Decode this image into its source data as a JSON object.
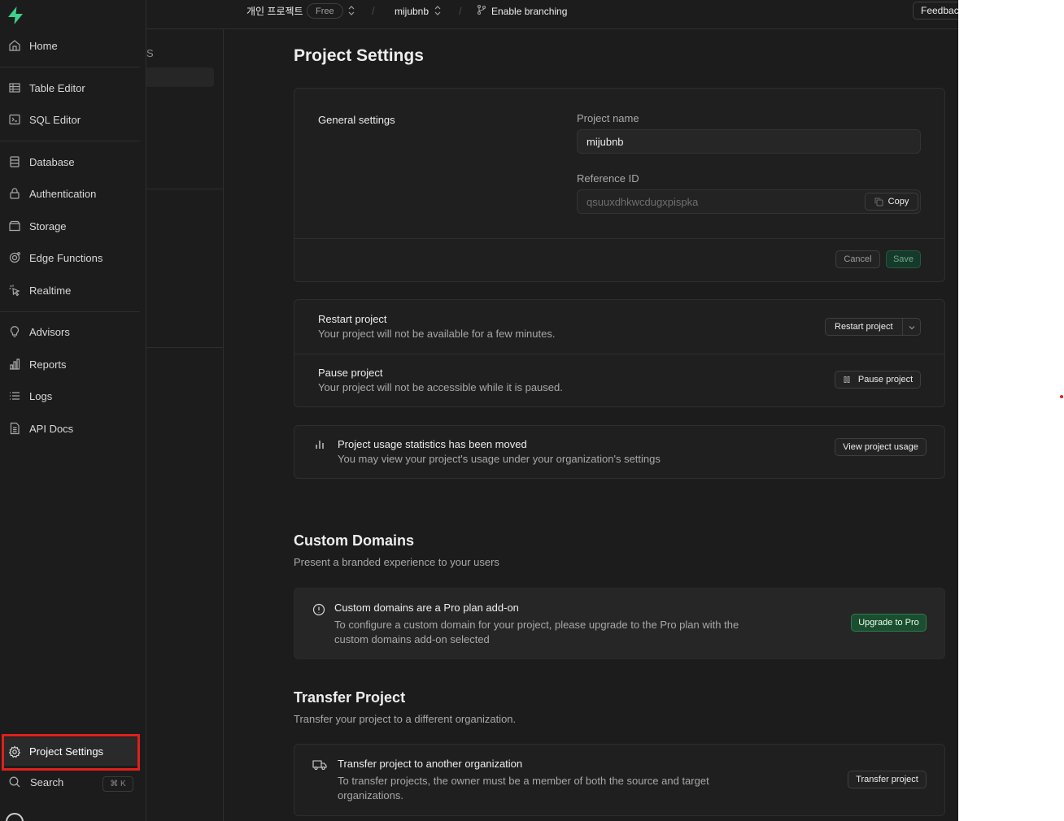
{
  "sidebar": {
    "items": [
      {
        "label": "Home",
        "icon": "home-icon"
      },
      {
        "label": "Table Editor",
        "icon": "table-icon"
      },
      {
        "label": "SQL Editor",
        "icon": "terminal-icon"
      },
      {
        "label": "Database",
        "icon": "database-icon"
      },
      {
        "label": "Authentication",
        "icon": "lock-icon"
      },
      {
        "label": "Storage",
        "icon": "archive-icon"
      },
      {
        "label": "Edge Functions",
        "icon": "edge-functions-icon"
      },
      {
        "label": "Realtime",
        "icon": "cursor-click-icon"
      },
      {
        "label": "Advisors",
        "icon": "lightbulb-icon"
      },
      {
        "label": "Reports",
        "icon": "chart-icon"
      },
      {
        "label": "Logs",
        "icon": "list-icon"
      },
      {
        "label": "API Docs",
        "icon": "file-text-icon"
      }
    ],
    "project_settings_label": "Project Settings",
    "search_label": "Search",
    "search_shortcut": "⌘ K",
    "subnav_partial_text": "S"
  },
  "topbar": {
    "org_name": "개인 프로젝트",
    "plan_badge": "Free",
    "project_name": "mijubnb",
    "branching_label": "Enable branching",
    "feedback_label": "Feedback"
  },
  "page": {
    "title": "Project Settings"
  },
  "general": {
    "heading": "General settings",
    "project_name_label": "Project name",
    "project_name_value": "mijubnb",
    "reference_id_label": "Reference ID",
    "reference_id_value": "qsuuxdhkwcdugxpispka",
    "copy_label": "Copy",
    "cancel_label": "Cancel",
    "save_label": "Save"
  },
  "restart": {
    "title": "Restart project",
    "desc": "Your project will not be available for a few minutes.",
    "button": "Restart project"
  },
  "pause": {
    "title": "Pause project",
    "desc": "Your project will not be accessible while it is paused.",
    "button": "Pause project"
  },
  "usage": {
    "title": "Project usage statistics has been moved",
    "desc": "You may view your project's usage under your organization's settings",
    "button": "View project usage"
  },
  "custom_domains": {
    "heading": "Custom Domains",
    "subheading": "Present a branded experience to your users",
    "notice_title": "Custom domains are a Pro plan add-on",
    "notice_desc_1": "To configure a custom domain for your project, please upgrade to the Pro plan with the",
    "notice_desc_2": "custom domains add-on selected",
    "button": "Upgrade to Pro"
  },
  "transfer": {
    "heading": "Transfer Project",
    "subheading": "Transfer your project to a different organization.",
    "title": "Transfer project to another organization",
    "desc_1": "To transfer projects, the owner must be a member of both the source and target",
    "desc_2": "organizations.",
    "button": "Transfer project"
  },
  "colors": {
    "brand": "#3ecf8e",
    "highlight": "#e0201b",
    "background": "#1c1c1c"
  }
}
